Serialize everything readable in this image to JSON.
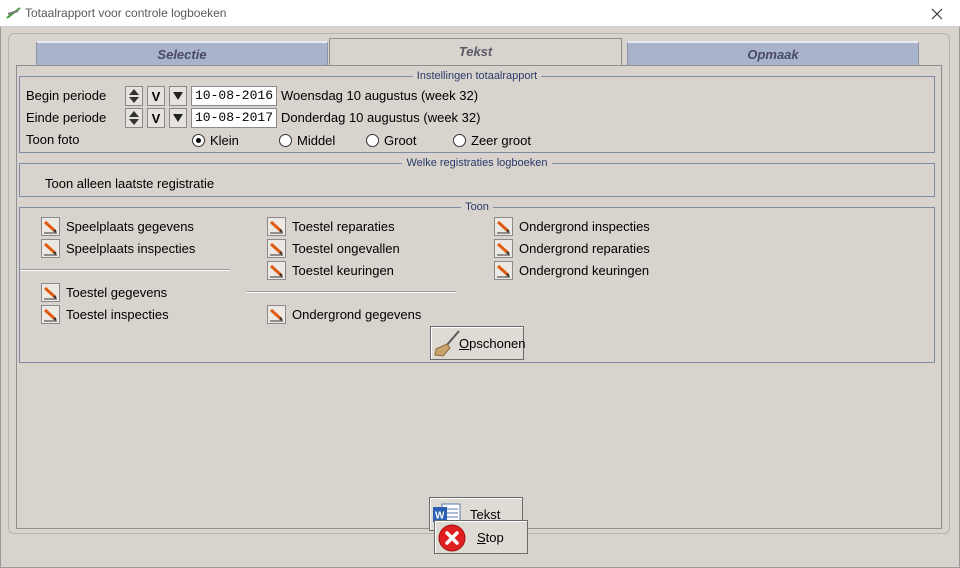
{
  "window": {
    "title": "Totaalrapport voor controle logboeken"
  },
  "tabs": [
    {
      "label": "Selectie",
      "active": false
    },
    {
      "label": "Tekst",
      "active": true
    },
    {
      "label": "Opmaak",
      "active": false
    }
  ],
  "settings": {
    "title": "Instellingen totaalrapport",
    "begin_label": "Begin periode",
    "begin_date": "10-08-2016",
    "begin_desc": "Woensdag 10 augustus (week 32)",
    "end_label": "Einde periode",
    "end_date": "10-08-2017",
    "end_desc": "Donderdag 10 augustus (week 32)",
    "v_label": "V",
    "photo_label": "Toon foto",
    "photo_options": [
      "Klein",
      "Middel",
      "Groot",
      "Zeer groot"
    ],
    "photo_selected": "Klein"
  },
  "registrations": {
    "title": "Welke registraties logboeken",
    "text": "Toon alleen laatste registratie"
  },
  "toon": {
    "title": "Toon",
    "col1a": [
      "Speelplaats gegevens",
      "Speelplaats inspecties"
    ],
    "col1b": [
      "Toestel gegevens",
      "Toestel inspecties"
    ],
    "col2a": [
      "Toestel reparaties",
      "Toestel ongevallen",
      "Toestel keuringen"
    ],
    "col2b": [
      "Ondergrond gegevens"
    ],
    "col3": [
      "Ondergrond inspecties",
      "Ondergrond reparaties",
      "Ondergrond keuringen"
    ],
    "clean_first": "O",
    "clean_rest": "pschonen"
  },
  "buttons": {
    "tekst_first": "T",
    "tekst_rest": "ekst",
    "stop_first": "S",
    "stop_rest": "top"
  },
  "colors": {
    "inactive_tab": "#a9b4cc",
    "group_border": "#7e8aa6",
    "stop_red": "#e02020"
  }
}
